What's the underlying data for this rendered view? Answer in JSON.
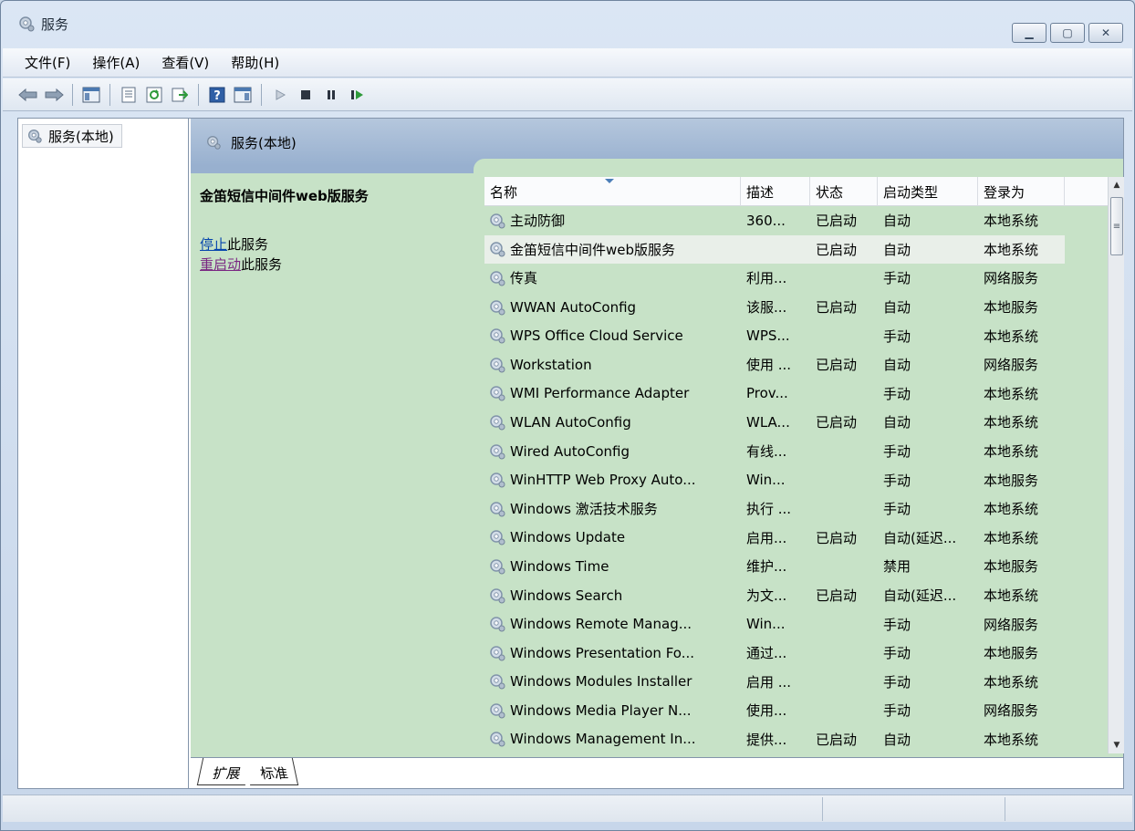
{
  "window": {
    "title": "服务",
    "controls": [
      "minimize-button",
      "maximize-button",
      "close-button"
    ]
  },
  "menu": [
    "文件(F)",
    "操作(A)",
    "查看(V)",
    "帮助(H)"
  ],
  "toolbar": {
    "icons": [
      "back-icon",
      "forward-icon",
      "show-hide-console-tree-icon",
      "properties-icon",
      "refresh-icon",
      "export-list-icon",
      "help-icon",
      "action-pane-icon",
      "start-service-icon",
      "stop-service-icon",
      "pause-service-icon",
      "restart-service-icon"
    ]
  },
  "tree": {
    "root": "服务(本地)"
  },
  "panel": {
    "header": "服务(本地)",
    "selected_service": "金笛短信中间件web版服务",
    "stop_link": "停止",
    "stop_suffix": "此服务",
    "restart_link": "重启动",
    "restart_suffix": "此服务"
  },
  "columns": [
    "名称",
    "描述",
    "状态",
    "启动类型",
    "登录为"
  ],
  "services": [
    {
      "name": "主动防御",
      "desc": "360...",
      "state": "已启动",
      "start": "自动",
      "login": "本地系统"
    },
    {
      "name": "金笛短信中间件web版服务",
      "desc": "",
      "state": "已启动",
      "start": "自动",
      "login": "本地系统",
      "selected": true
    },
    {
      "name": "传真",
      "desc": "利用...",
      "state": "",
      "start": "手动",
      "login": "网络服务"
    },
    {
      "name": "WWAN AutoConfig",
      "desc": "该服...",
      "state": "已启动",
      "start": "自动",
      "login": "本地服务"
    },
    {
      "name": "WPS Office Cloud Service",
      "desc": "WPS...",
      "state": "",
      "start": "手动",
      "login": "本地系统"
    },
    {
      "name": "Workstation",
      "desc": "使用 ...",
      "state": "已启动",
      "start": "自动",
      "login": "网络服务"
    },
    {
      "name": "WMI Performance Adapter",
      "desc": "Prov...",
      "state": "",
      "start": "手动",
      "login": "本地系统"
    },
    {
      "name": "WLAN AutoConfig",
      "desc": "WLA...",
      "state": "已启动",
      "start": "自动",
      "login": "本地系统"
    },
    {
      "name": "Wired AutoConfig",
      "desc": "有线...",
      "state": "",
      "start": "手动",
      "login": "本地系统"
    },
    {
      "name": "WinHTTP Web Proxy Auto...",
      "desc": "Win...",
      "state": "",
      "start": "手动",
      "login": "本地服务"
    },
    {
      "name": "Windows 激活技术服务",
      "desc": "执行 ...",
      "state": "",
      "start": "手动",
      "login": "本地系统"
    },
    {
      "name": "Windows Update",
      "desc": "启用...",
      "state": "已启动",
      "start": "自动(延迟...",
      "login": "本地系统"
    },
    {
      "name": "Windows Time",
      "desc": "维护...",
      "state": "",
      "start": "禁用",
      "login": "本地服务"
    },
    {
      "name": "Windows Search",
      "desc": "为文...",
      "state": "已启动",
      "start": "自动(延迟...",
      "login": "本地系统"
    },
    {
      "name": "Windows Remote Manag...",
      "desc": "Win...",
      "state": "",
      "start": "手动",
      "login": "网络服务"
    },
    {
      "name": "Windows Presentation Fo...",
      "desc": "通过...",
      "state": "",
      "start": "手动",
      "login": "本地服务"
    },
    {
      "name": "Windows Modules Installer",
      "desc": "启用 ...",
      "state": "",
      "start": "手动",
      "login": "本地系统"
    },
    {
      "name": "Windows Media Player N...",
      "desc": "使用...",
      "state": "",
      "start": "手动",
      "login": "网络服务"
    },
    {
      "name": "Windows Management In...",
      "desc": "提供...",
      "state": "已启动",
      "start": "自动",
      "login": "本地系统"
    }
  ],
  "tabs": [
    "扩展",
    "标准"
  ]
}
